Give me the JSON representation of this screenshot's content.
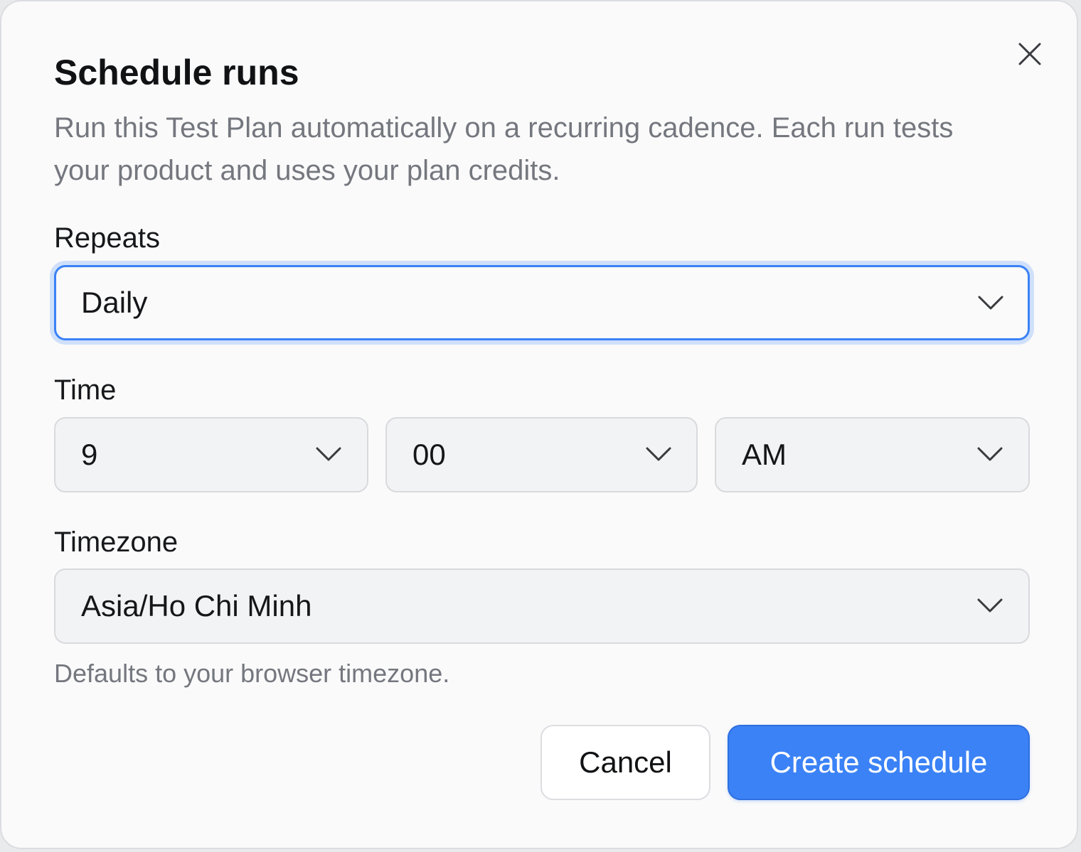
{
  "dialog": {
    "title": "Schedule runs",
    "description": "Run this Test Plan automatically on a recurring cadence. Each run tests your product and uses your plan credits."
  },
  "repeats": {
    "label": "Repeats",
    "value": "Daily"
  },
  "time": {
    "label": "Time",
    "hour": "9",
    "minute": "00",
    "period": "AM"
  },
  "timezone": {
    "label": "Timezone",
    "value": "Asia/Ho Chi Minh",
    "hint": "Defaults to your browser timezone."
  },
  "actions": {
    "cancel_label": "Cancel",
    "create_label": "Create schedule"
  },
  "colors": {
    "accent": "#3b82f6",
    "focus_ring": "#cfe0fb",
    "muted_text": "#74777e",
    "field_background": "#f2f3f5"
  },
  "icons": {
    "close": "close-icon",
    "dropdown": "chevron-down-icon"
  }
}
